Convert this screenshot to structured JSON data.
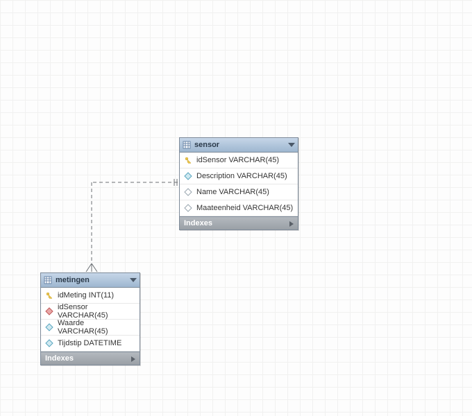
{
  "entities": {
    "sensor": {
      "title": "sensor",
      "indexes_label": "Indexes",
      "columns": [
        {
          "label": "idSensor VARCHAR(45)",
          "icon": "key"
        },
        {
          "label": "Description VARCHAR(45)",
          "icon": "diamond-blue"
        },
        {
          "label": "Name VARCHAR(45)",
          "icon": "diamond-open"
        },
        {
          "label": "Maateenheid VARCHAR(45)",
          "icon": "diamond-open"
        }
      ]
    },
    "metingen": {
      "title": "metingen",
      "indexes_label": "Indexes",
      "columns": [
        {
          "label": "idMeting INT(11)",
          "icon": "key"
        },
        {
          "label": "idSensor VARCHAR(45)",
          "icon": "diamond-red"
        },
        {
          "label": "Waarde VARCHAR(45)",
          "icon": "diamond-blue"
        },
        {
          "label": "Tijdstip DATETIME",
          "icon": "diamond-blue"
        }
      ]
    }
  },
  "relationship": {
    "from": "metingen.idSensor",
    "to": "sensor.idSensor",
    "cardinality_from": "many",
    "cardinality_to": "one"
  }
}
